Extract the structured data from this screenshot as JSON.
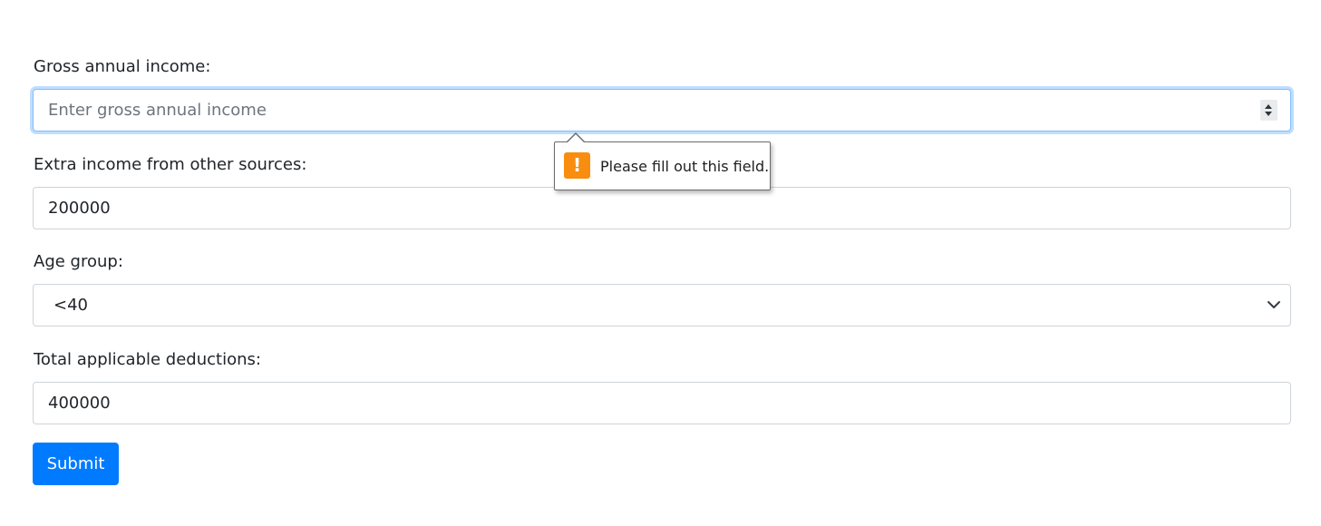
{
  "form": {
    "gross_income": {
      "label": "Gross annual income:",
      "placeholder": "Enter gross annual income",
      "value": ""
    },
    "extra_income": {
      "label": "Extra income from other sources:",
      "value": "200000"
    },
    "age_group": {
      "label": "Age group:",
      "selected": "<40"
    },
    "deductions": {
      "label": "Total applicable deductions:",
      "value": "400000"
    },
    "submit_label": "Submit"
  },
  "validation_tooltip": {
    "message": "Please fill out this field.",
    "icon": "warning-icon",
    "icon_glyph": "!"
  },
  "colors": {
    "primary": "#007bff",
    "focus_border": "#80bdff",
    "warning": "#f98d0f"
  }
}
